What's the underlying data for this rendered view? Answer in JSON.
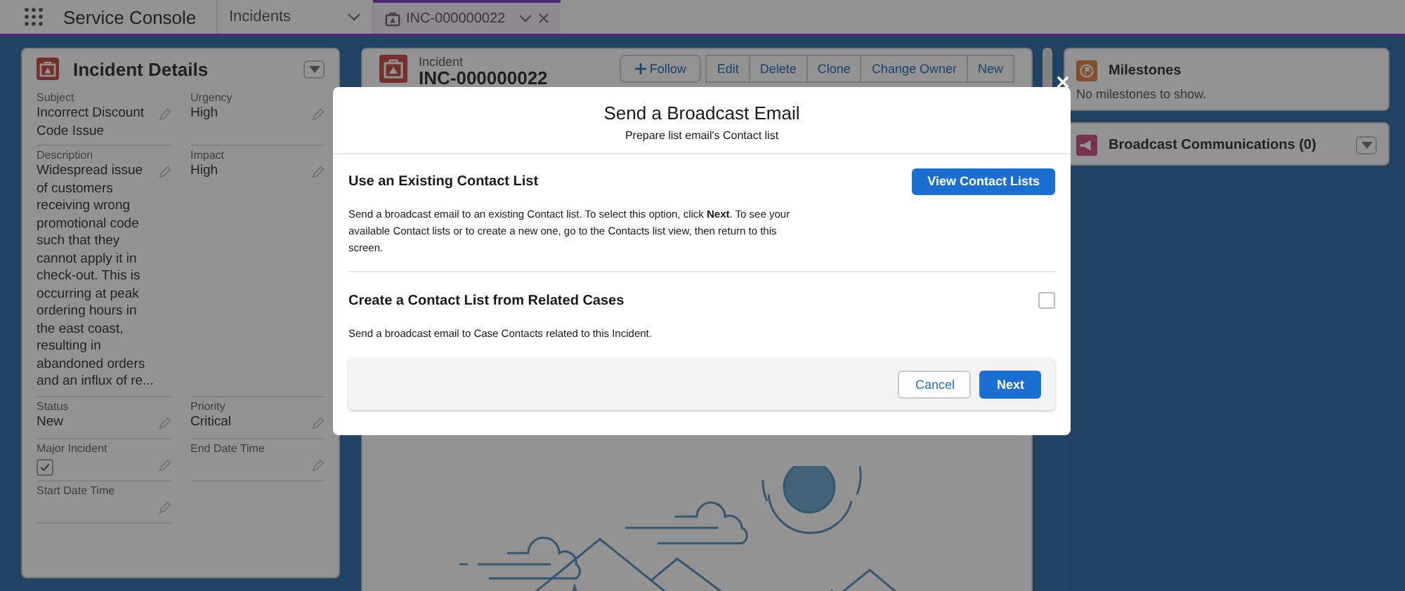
{
  "app_bar": {
    "title": "Service Console",
    "tabs": [
      {
        "label": "Incidents",
        "kind": "object",
        "selected": false
      },
      {
        "label": "INC-000000022",
        "kind": "record",
        "selected": true
      }
    ]
  },
  "incident_details": {
    "title": "Incident Details",
    "fields": [
      {
        "label": "Subject",
        "value": "Incorrect Discount Code Issue",
        "kind": "text"
      },
      {
        "label": "Urgency",
        "value": "High",
        "kind": "text"
      },
      {
        "label": "Description",
        "value": "Widespread issue of customers receiving wrong promotional code such that they cannot apply it in check-out. This is occurring at peak ordering hours in the east coast, resulting in abandoned orders and an influx of re...",
        "kind": "text"
      },
      {
        "label": "Impact",
        "value": "High",
        "kind": "text"
      },
      {
        "label": "Status",
        "value": "New",
        "kind": "text"
      },
      {
        "label": "Priority",
        "value": "Critical",
        "kind": "text"
      },
      {
        "label": "Major Incident",
        "checked": true,
        "kind": "checkbox"
      },
      {
        "label": "End Date Time",
        "kind": "text"
      },
      {
        "label": "Start Date Time",
        "kind": "text"
      }
    ]
  },
  "record": {
    "object_label": "Incident",
    "name": "INC-000000022",
    "actions": [
      {
        "label": "Follow",
        "kind": "follow"
      },
      {
        "label": "Edit",
        "kind": "plain"
      },
      {
        "label": "Delete",
        "kind": "plain"
      },
      {
        "label": "Clone",
        "kind": "plain"
      },
      {
        "label": "Change Owner",
        "kind": "plain"
      },
      {
        "label": "New",
        "kind": "plain"
      }
    ]
  },
  "side_panel": {
    "milestones": {
      "title": "Milestones",
      "empty_text": "No milestones to show."
    },
    "broadcast": {
      "title": "Broadcast Communications (0)"
    }
  },
  "modal": {
    "title": "Send a Broadcast Email",
    "subtitle": "Prepare list email's Contact list",
    "sections": [
      {
        "heading": "Use an Existing Contact List",
        "text": "Send a broadcast email to an existing Contact list. To select this option, click **Next**. To see your available Contact lists or to create a new one, go to the Contacts list view, then return to this screen.",
        "kind": "button",
        "button_label": "View Contact Lists"
      },
      {
        "heading": "Create a Contact List from Related Cases",
        "text": "Send a broadcast email to Case Contacts related to this Incident.",
        "kind": "checkbox",
        "checked": false
      }
    ],
    "footer": [
      {
        "label": "Cancel",
        "kind": "neutral"
      },
      {
        "label": "Next",
        "kind": "brand"
      }
    ]
  }
}
